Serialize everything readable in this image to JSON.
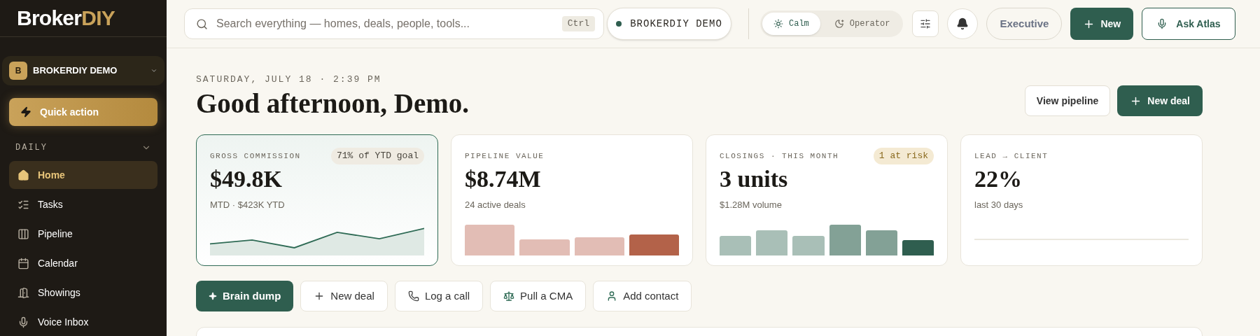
{
  "sidebar": {
    "logo": {
      "part_1": "Broker",
      "part_2": "DIY"
    },
    "workspace": {
      "initial": "B",
      "name": "BROKERDIY DEMO"
    },
    "quick_action": "Quick action",
    "section": {
      "title": "DAILY",
      "expanded": true
    },
    "items": [
      {
        "label": "Home",
        "selected": true
      },
      {
        "label": "Tasks",
        "selected": false
      },
      {
        "label": "Pipeline",
        "selected": false
      },
      {
        "label": "Calendar",
        "selected": false
      },
      {
        "label": "Showings",
        "selected": false
      },
      {
        "label": "Voice Inbox",
        "selected": false
      }
    ]
  },
  "top_bar": {
    "search": {
      "placeholder": "Search everything — homes, deals, people, tools...",
      "shortcut": "Ctrl"
    },
    "workspace_pill": "BROKERDIY DEMO",
    "modes": [
      {
        "label": "Calm",
        "selected": true
      },
      {
        "label": "Operator",
        "selected": false
      }
    ],
    "view": "Executive",
    "new_button": "New",
    "ask_button": "Ask Atlas"
  },
  "header": {
    "date": "SATURDAY, JULY 18 · 2:39 PM",
    "greeting": "Good afternoon, Demo.",
    "actions": [
      {
        "label": "View pipeline",
        "kind": "secondary"
      },
      {
        "label": "New deal",
        "kind": "primary"
      }
    ]
  },
  "metrics": [
    {
      "label": "GROSS COMMISSION",
      "value": "$49.8K",
      "sub": "MTD · $423K YTD",
      "badge": {
        "text": "71% of YTD goal",
        "kind": "goal"
      },
      "kind": "line",
      "selected": true
    },
    {
      "label": "PIPELINE VALUE",
      "value": "$8.74M",
      "sub": "24 active deals",
      "kind": "bars_rose",
      "selected": false
    },
    {
      "label": "CLOSINGS · THIS MONTH",
      "value": "3 units",
      "sub": "$1.28M volume",
      "badge": {
        "text": "1 at risk",
        "kind": "risk"
      },
      "kind": "bars_sage",
      "selected": false
    },
    {
      "label": "LEAD → CLIENT",
      "value": "22%",
      "sub": "last 30 days",
      "kind": "flat",
      "selected": false
    }
  ],
  "quick_actions": [
    {
      "label": "Brain dump",
      "kind": "primary"
    },
    {
      "label": "New deal",
      "kind": "secondary"
    },
    {
      "label": "Log a call",
      "kind": "secondary"
    },
    {
      "label": "Pull a CMA",
      "kind": "secondary"
    },
    {
      "label": "Add contact",
      "kind": "secondary"
    }
  ]
}
